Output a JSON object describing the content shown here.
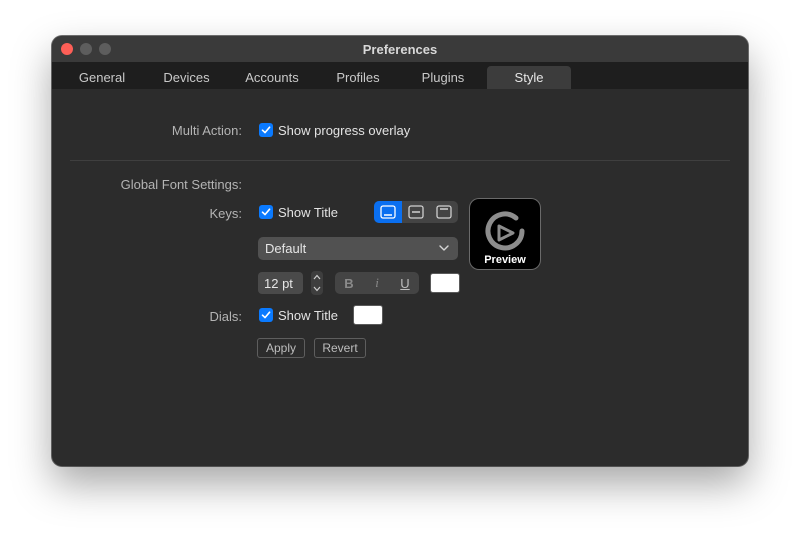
{
  "window": {
    "title": "Preferences"
  },
  "tabs": [
    {
      "label": "General"
    },
    {
      "label": "Devices"
    },
    {
      "label": "Accounts"
    },
    {
      "label": "Profiles"
    },
    {
      "label": "Plugins"
    },
    {
      "label": "Style",
      "active": true
    }
  ],
  "multi_action": {
    "label": "Multi Action:",
    "checkbox_label": "Show progress overlay",
    "checked": true
  },
  "global_font": {
    "section_label": "Global Font Settings:",
    "keys": {
      "label": "Keys:",
      "show_title_label": "Show Title",
      "show_title_checked": true,
      "alignment_options": [
        "bottom-align-icon",
        "middle-align-icon",
        "top-align-icon"
      ],
      "alignment_selected": "bottom-align-icon",
      "font_value": "Default",
      "size_value": "12 pt",
      "style_buttons": [
        "B",
        "I",
        "U"
      ],
      "color": "#ffffff",
      "preview_label": "Preview"
    },
    "dials": {
      "label": "Dials:",
      "show_title_label": "Show Title",
      "show_title_checked": true,
      "color": "#ffffff"
    }
  },
  "buttons": {
    "apply": "Apply",
    "revert": "Revert"
  },
  "colors": {
    "accent": "#0a7aff",
    "background": "#2c2c2c"
  }
}
